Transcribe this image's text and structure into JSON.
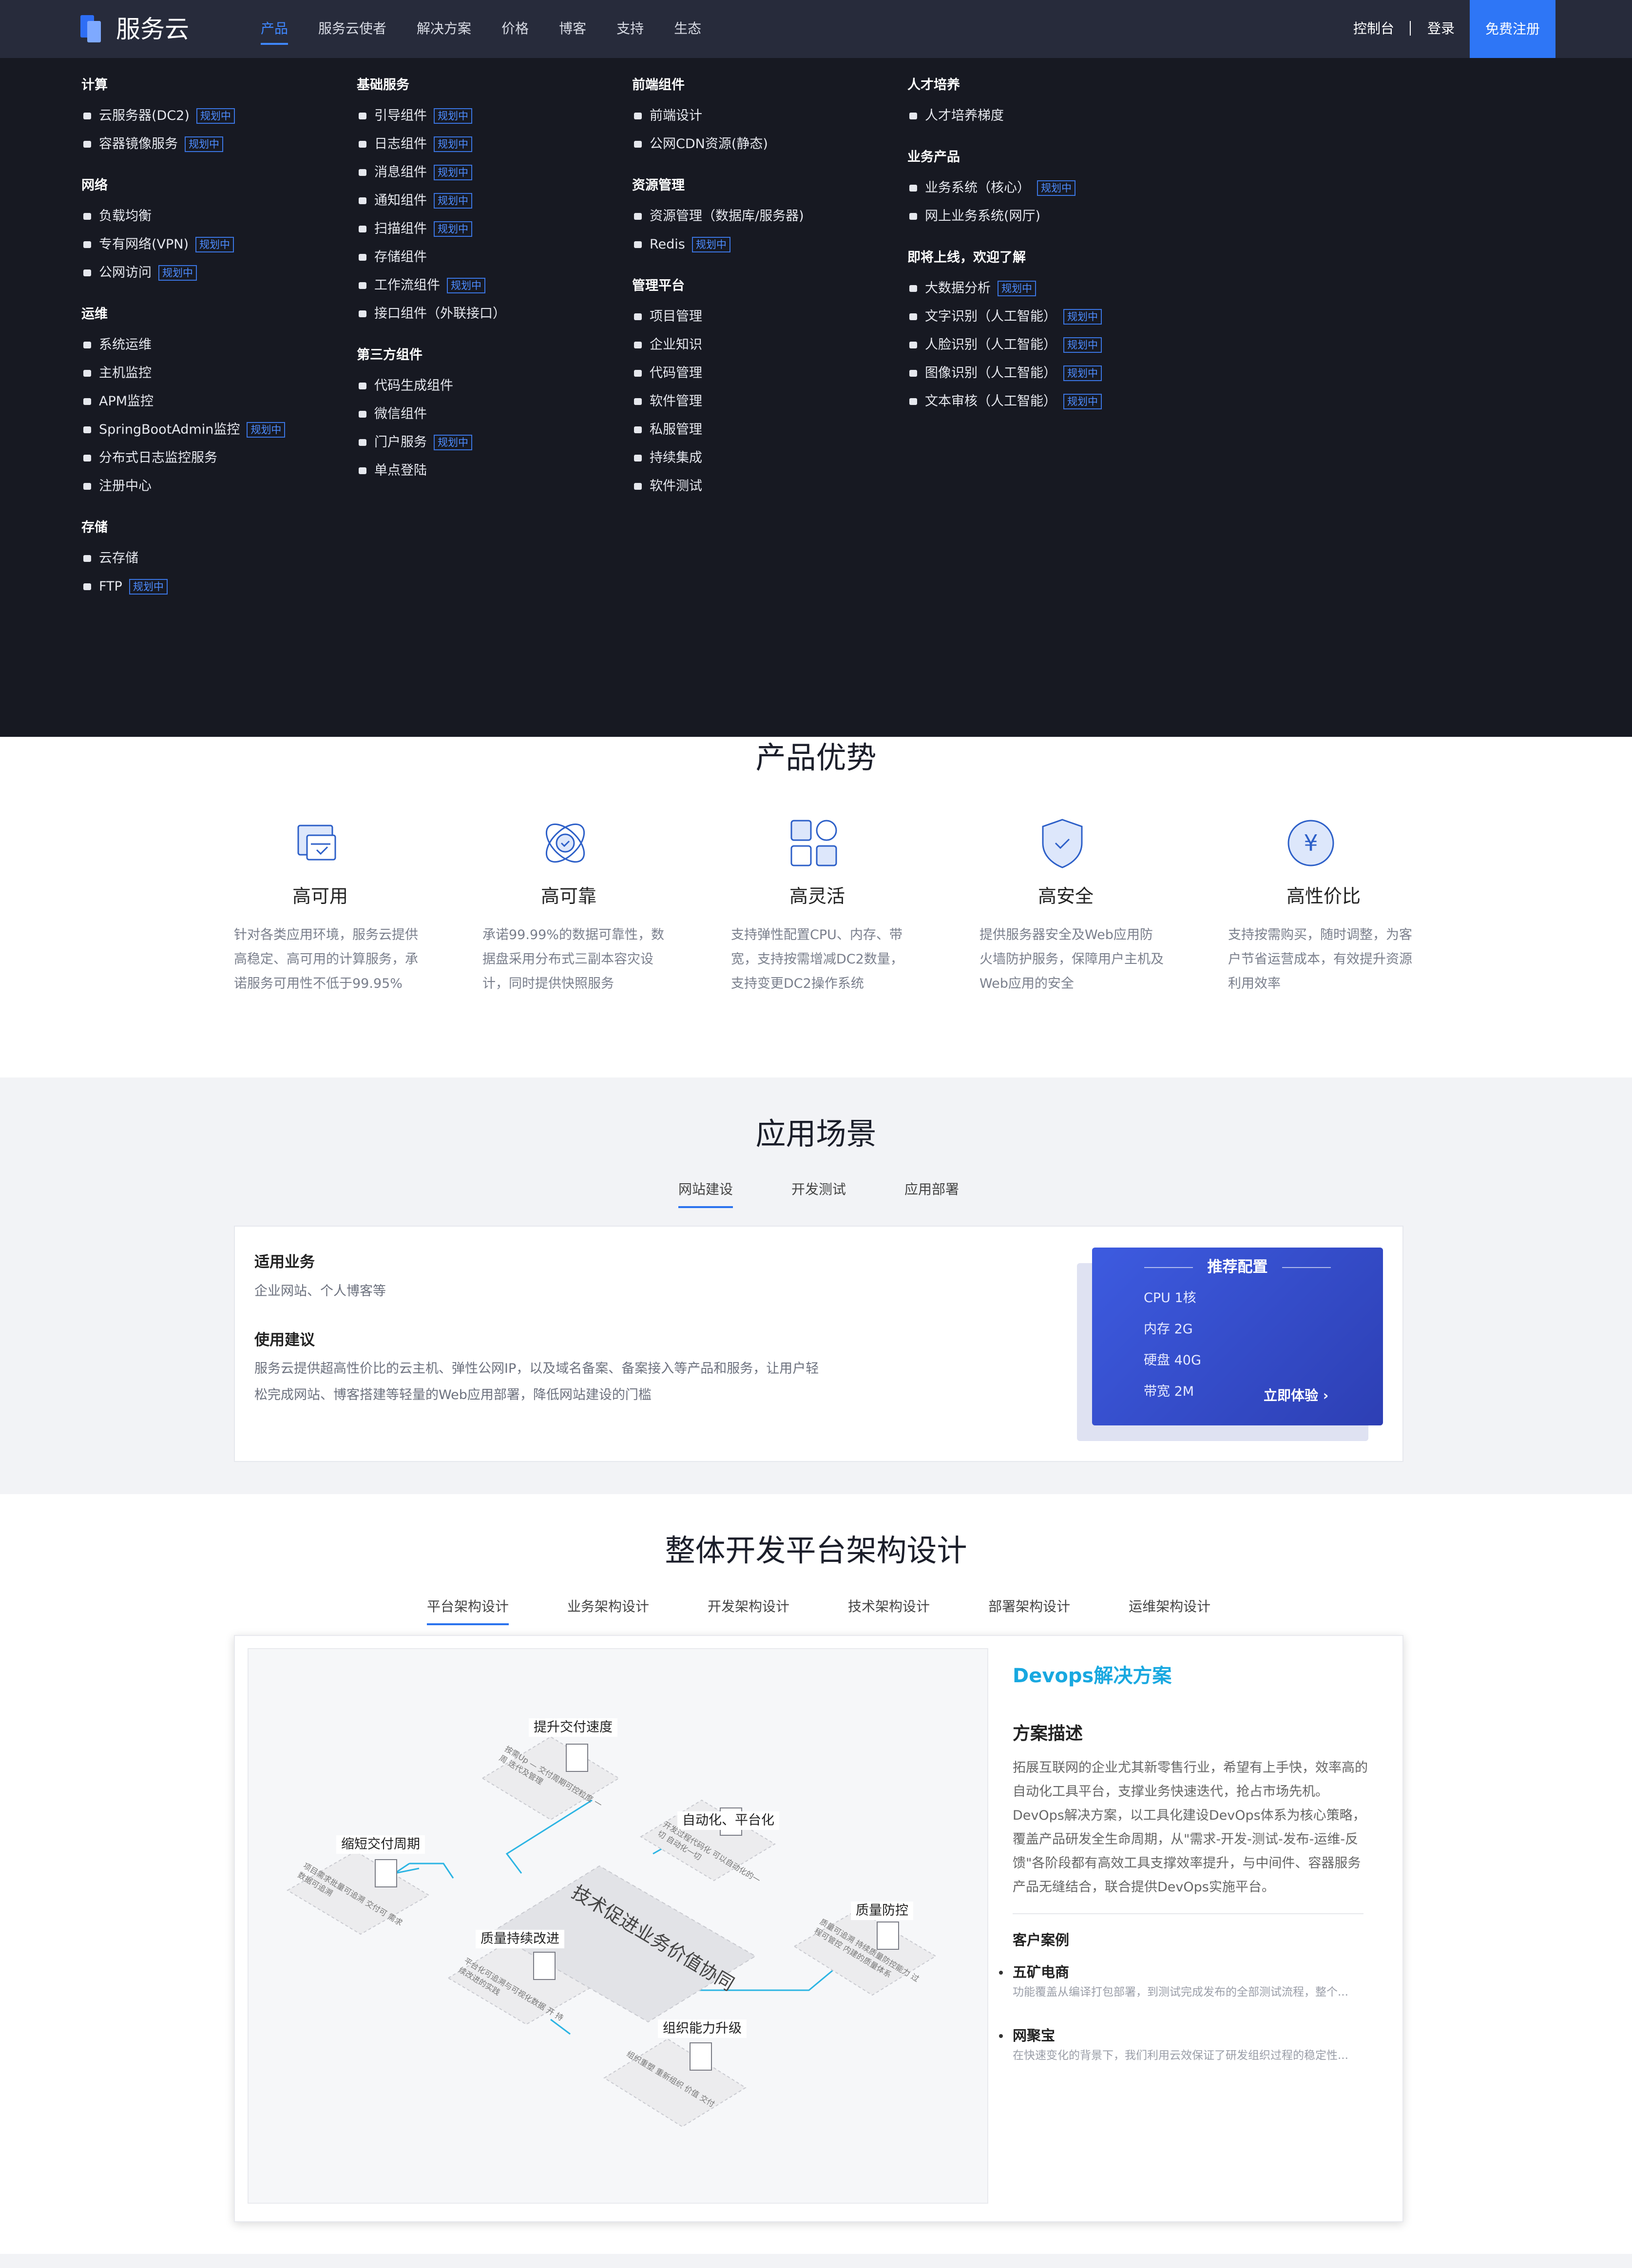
{
  "header": {
    "brand": "服务云",
    "nav": [
      "产品",
      "服务云使者",
      "解决方案",
      "价格",
      "博客",
      "支持",
      "生态"
    ],
    "console": "控制台",
    "login": "登录",
    "register": "免费注册"
  },
  "menu": {
    "badge": "规划中",
    "col1": [
      {
        "title": "计算",
        "items": [
          {
            "label": "云服务器(DC2)",
            "badge": true
          },
          {
            "label": "容器镜像服务",
            "badge": true
          }
        ]
      },
      {
        "title": "网络",
        "items": [
          {
            "label": "负载均衡",
            "badge": false
          },
          {
            "label": "专有网络(VPN)",
            "badge": true
          },
          {
            "label": "公网访问",
            "badge": true
          }
        ]
      },
      {
        "title": "运维",
        "items": [
          {
            "label": "系统运维",
            "badge": false
          },
          {
            "label": "主机监控",
            "badge": false
          },
          {
            "label": "APM监控",
            "badge": false
          },
          {
            "label": "SpringBootAdmin监控",
            "badge": true
          },
          {
            "label": "分布式日志监控服务",
            "badge": false
          },
          {
            "label": "注册中心",
            "badge": false
          }
        ]
      },
      {
        "title": "存储",
        "items": [
          {
            "label": "云存储",
            "badge": false
          },
          {
            "label": "FTP",
            "badge": true
          }
        ]
      }
    ],
    "col2": [
      {
        "title": "基础服务",
        "items": [
          {
            "label": "引导组件",
            "badge": true
          },
          {
            "label": "日志组件",
            "badge": true
          },
          {
            "label": "消息组件",
            "badge": true
          },
          {
            "label": "通知组件",
            "badge": true
          },
          {
            "label": "扫描组件",
            "badge": true
          },
          {
            "label": "存储组件",
            "badge": false
          },
          {
            "label": "工作流组件",
            "badge": true
          },
          {
            "label": "接口组件（外联接口）",
            "badge": false
          }
        ]
      },
      {
        "title": "第三方组件",
        "items": [
          {
            "label": "代码生成组件",
            "badge": false
          },
          {
            "label": "微信组件",
            "badge": false
          },
          {
            "label": "门户服务",
            "badge": true
          },
          {
            "label": "单点登陆",
            "badge": false
          }
        ]
      }
    ],
    "col3": [
      {
        "title": "前端组件",
        "items": [
          {
            "label": "前端设计",
            "badge": false
          },
          {
            "label": "公网CDN资源(静态)",
            "badge": false
          }
        ]
      },
      {
        "title": "资源管理",
        "items": [
          {
            "label": "资源管理（数据库/服务器)",
            "badge": false
          },
          {
            "label": "Redis",
            "badge": true
          }
        ]
      },
      {
        "title": "管理平台",
        "items": [
          {
            "label": "项目管理",
            "badge": false
          },
          {
            "label": "企业知识",
            "badge": false
          },
          {
            "label": "代码管理",
            "badge": false
          },
          {
            "label": "软件管理",
            "badge": false
          },
          {
            "label": "私服管理",
            "badge": false
          },
          {
            "label": "持续集成",
            "badge": false
          },
          {
            "label": "软件测试",
            "badge": false
          }
        ]
      }
    ],
    "col4": [
      {
        "title": "人才培养",
        "items": [
          {
            "label": "人才培养梯度",
            "badge": false
          }
        ]
      },
      {
        "title": "业务产品",
        "items": [
          {
            "label": "业务系统（核心）",
            "badge": true
          },
          {
            "label": "网上业务系统(网厅)",
            "badge": false
          }
        ]
      },
      {
        "title": "即将上线，欢迎了解",
        "items": [
          {
            "label": "大数据分析",
            "badge": true
          },
          {
            "label": "文字识别（人工智能）",
            "badge": true
          },
          {
            "label": "人脸识别（人工智能）",
            "badge": true
          },
          {
            "label": "图像识别（人工智能）",
            "badge": true
          },
          {
            "label": "文本审核（人工智能）",
            "badge": true
          }
        ]
      }
    ]
  },
  "advantages": {
    "title": "产品优势",
    "items": [
      {
        "title": "高可用",
        "desc": "针对各类应用环境，服务云提供高稳定、高可用的计算服务，承诺服务可用性不低于99.95%"
      },
      {
        "title": "高可靠",
        "desc": "承诺99.99%的数据可靠性，数据盘采用分布式三副本容灾设计，同时提供快照服务"
      },
      {
        "title": "高灵活",
        "desc": "支持弹性配置CPU、内存、带宽，支持按需增减DC2数量，支持变更DC2操作系统"
      },
      {
        "title": "高安全",
        "desc": "提供服务器安全及Web应用防火墙防护服务，保障用户主机及Web应用的安全"
      },
      {
        "title": "高性价比",
        "desc": "支持按需购买，随时调整，为客户节省运营成本，有效提升资源利用效率"
      }
    ]
  },
  "scenes": {
    "title": "应用场景",
    "tabs": [
      "网站建设",
      "开发测试",
      "应用部署"
    ],
    "business_title": "适用业务",
    "business_text": "企业网站、个人博客等",
    "advice_title": "使用建议",
    "advice_line1": "服务云提供超高性价比的云主机、弹性公网IP，以及域名备案、备案接入等产品和服务，让用户轻",
    "advice_line2": "松完成网站、博客搭建等轻量的Web应用部署，降低网站建设的门槛",
    "rec_title": "推荐配置",
    "rec_items": [
      "CPU 1核",
      "内存 2G",
      "硬盘 40G",
      "带宽 2M"
    ],
    "rec_button": "立即体验 ›"
  },
  "arch": {
    "title": "整体开发平台架构设计",
    "tabs": [
      "平台架构设计",
      "业务架构设计",
      "开发架构设计",
      "技术架构设计",
      "部署架构设计",
      "运维架构设计"
    ],
    "diagram": {
      "center": "技术促进业务价值协同",
      "labels": [
        "提升交付速度",
        "自动化、平台化",
        "缩短交付周期",
        "质量持续改进",
        "质量防控",
        "组织能力升级"
      ],
      "notes": [
        "按需Up — 交付周期可控粒度  一周  迭代及管理",
        "开发过程代码化  可以自动化的一切  自动化一切",
        "项目需求批量可追溯  交付可  需求  数据可追溯",
        "平台化可追溯与可视化数据  开  持续改进的实践",
        "质量可追溯  持续质量防控能力  过程可管控  内建的质量体系",
        "组织重塑  重新组织  价值  交付"
      ]
    },
    "solution_title": "Devops解决方案",
    "desc_title": "方案描述",
    "desc": "拓展互联网的企业尤其新零售行业，希望有上手快，效率高的自动化工具平台，支撑业务快速迭代，抢占市场先机。DevOps解决方案，以工具化建设DevOps体系为核心策略，覆盖产品研发全生命周期，从\"需求-开发-测试-发布-运维-反馈\"各阶段都有高效工具支撑效率提升，与中间件、容器服务产品无缝结合，联合提供DevOps实施平台。",
    "cases_title": "客户案例",
    "cases": [
      {
        "name": "五矿电商",
        "desc": "功能覆盖从编译打包部署，到测试完成发布的全部测试流程，整个..."
      },
      {
        "name": "网聚宝",
        "desc": "在快速变化的背景下，我们利用云效保证了研发组织过程的稳定性..."
      }
    ]
  }
}
